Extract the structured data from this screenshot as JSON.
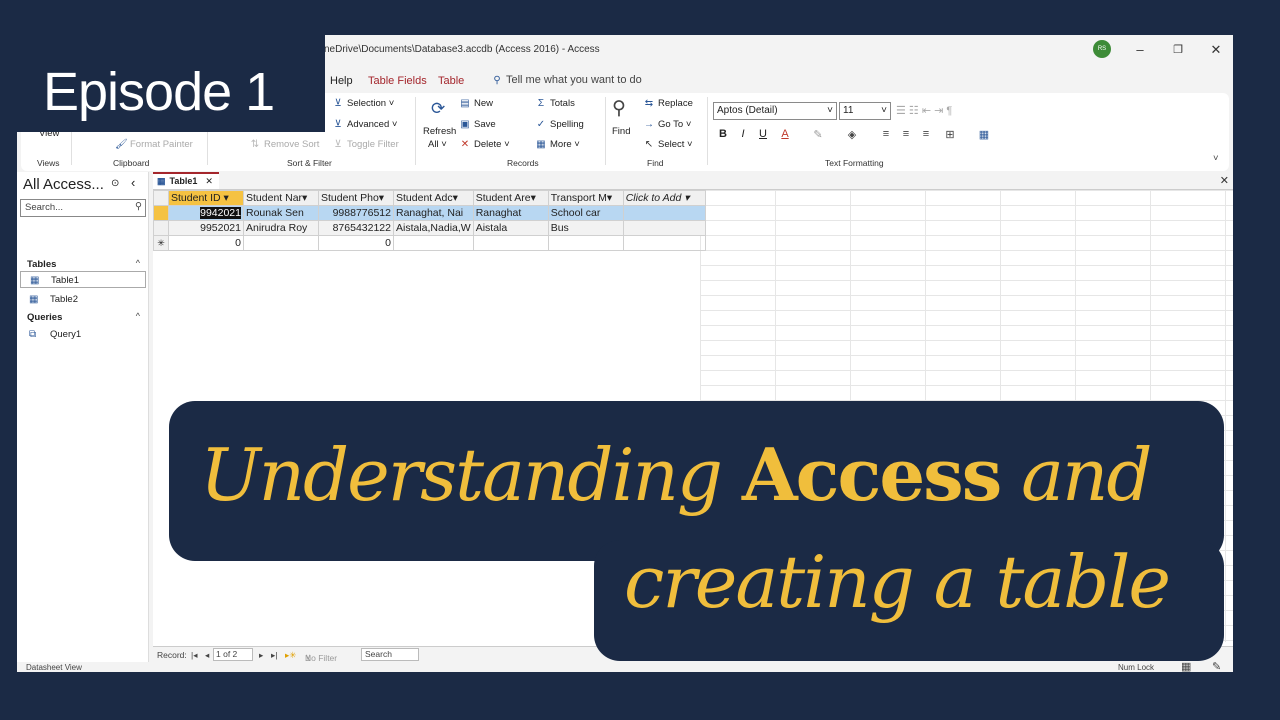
{
  "window": {
    "title": "neDrive\\Documents\\Database3.accdb (Access 2016)  -  Access",
    "avatar": "RS",
    "controls": [
      "–",
      "❐",
      "✕"
    ]
  },
  "menu": {
    "tabs": [
      "Help",
      "Table Fields",
      "Table"
    ],
    "tellme": "Tell me what you want to do"
  },
  "ribbon": {
    "views": {
      "label": "Views",
      "btn": "View"
    },
    "clipboard": {
      "label": "Clipboard",
      "format_painter": "Format Painter"
    },
    "sortfilter": {
      "label": "Sort & Filter",
      "selection": "Selection",
      "advanced": "Advanced",
      "toggle": "Toggle Filter",
      "remove_sort": "Remove Sort"
    },
    "records": {
      "label": "Records",
      "refresh": "Refresh",
      "refresh_sub": "All",
      "new": "New",
      "save": "Save",
      "delete": "Delete",
      "totals": "Totals",
      "spelling": "Spelling",
      "more": "More"
    },
    "find": {
      "label": "Find",
      "find": "Find",
      "replace": "Replace",
      "goto": "Go To",
      "select": "Select"
    },
    "text": {
      "label": "Text Formatting",
      "font": "Aptos (Detail)",
      "size": "11",
      "bold": "B",
      "italic": "I",
      "underline": "U"
    }
  },
  "nav": {
    "title": "All Access...",
    "search": "Search...",
    "tables_header": "Tables",
    "tables": [
      "Table1",
      "Table2"
    ],
    "queries_header": "Queries",
    "queries": [
      "Query1"
    ]
  },
  "doc": {
    "tab": "Table1",
    "columns": [
      "Student ID",
      "Student Nar",
      "Student Pho",
      "Student Adc",
      "Student Are",
      "Transport M",
      "Click to Add"
    ],
    "rows": [
      [
        "9942021",
        "Rounak Sen",
        "9988776512",
        "Ranaghat, Nai",
        "Ranaghat",
        "School car",
        ""
      ],
      [
        "9952021",
        "Anirudra Roy",
        "8765432122",
        "Aistala,Nadia,W",
        "Aistala",
        "Bus",
        ""
      ],
      [
        "0",
        "",
        "0",
        "",
        "",
        "",
        ""
      ]
    ],
    "new_row_marker": "✳",
    "record_nav": {
      "label": "Record:",
      "position": "1 of 2",
      "filter": "No Filter",
      "search": "Search"
    }
  },
  "status": {
    "left": "Datasheet View",
    "right": "Num Lock"
  },
  "overlay": {
    "episode": "Episode 1",
    "line1_a": "Understanding ",
    "line1_b": "Access",
    "line1_c": " and",
    "line2": "creating a table"
  }
}
